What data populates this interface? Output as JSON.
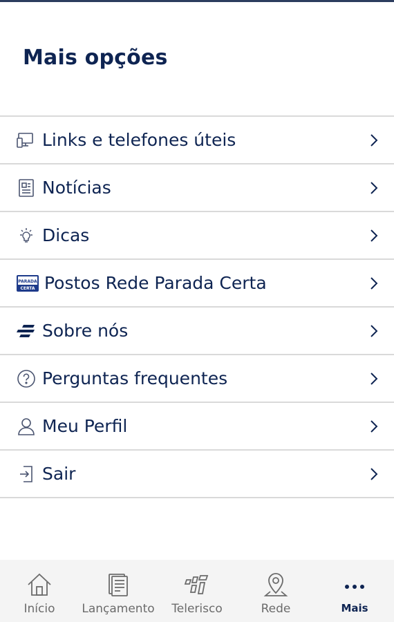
{
  "header": {
    "title": "Mais opções"
  },
  "menu": {
    "items": [
      {
        "label": "Links e telefones úteis",
        "icon": "monitor-phone-icon"
      },
      {
        "label": "Notícias",
        "icon": "newspaper-icon"
      },
      {
        "label": "Dicas",
        "icon": "lightbulb-icon"
      },
      {
        "label": "Postos Rede Parada Certa",
        "icon": "parada-certa-logo-icon"
      },
      {
        "label": "Sobre nós",
        "icon": "brand-stripes-icon"
      },
      {
        "label": "Perguntas frequentes",
        "icon": "question-circle-icon"
      },
      {
        "label": "Meu Perfil",
        "icon": "user-icon"
      },
      {
        "label": "Sair",
        "icon": "exit-icon"
      }
    ],
    "parada_certa_logo_text": "PARADA CERTA"
  },
  "bottom_nav": {
    "items": [
      {
        "label": "Início",
        "icon": "home-icon"
      },
      {
        "label": "Lançamento",
        "icon": "document-icon"
      },
      {
        "label": "Telerisco",
        "icon": "telerisco-icon"
      },
      {
        "label": "Rede",
        "icon": "location-pin-icon"
      },
      {
        "label": "Mais",
        "icon": "more-dots-icon",
        "active": true
      }
    ]
  },
  "colors": {
    "primary": "#0e2452",
    "divider": "#d9d9d9",
    "nav_bg": "#f4f4f4",
    "nav_inactive": "#6b6b6b"
  }
}
